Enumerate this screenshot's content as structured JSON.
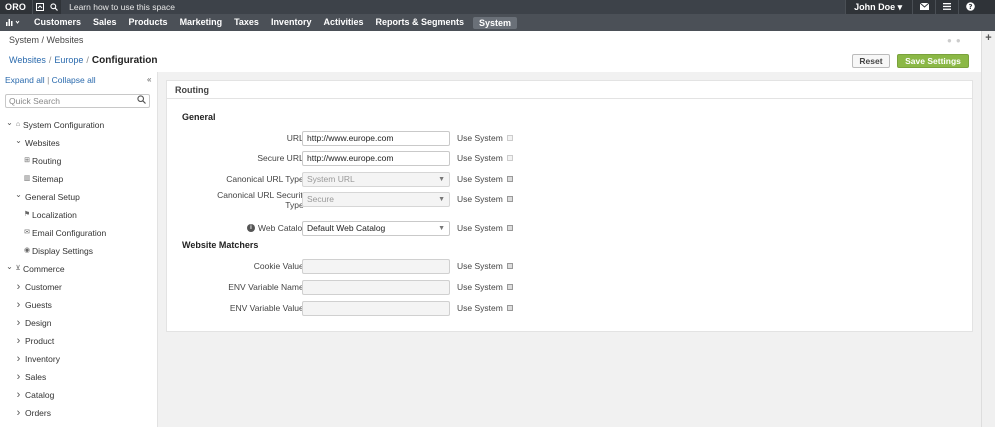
{
  "topbar": {
    "logo": "ORO",
    "learn_text": "Learn how to use this space",
    "user": "John Doe",
    "user_caret": "▾"
  },
  "menu": {
    "items": [
      "Customers",
      "Sales",
      "Products",
      "Marketing",
      "Taxes",
      "Inventory",
      "Activities",
      "Reports & Segments",
      "System"
    ],
    "active": "System"
  },
  "page": {
    "path": "System / Websites",
    "crumbs": [
      "Websites",
      "Europe"
    ],
    "crumb_sep": "/",
    "current": "Configuration",
    "reset_label": "Reset",
    "save_label": "Save Settings"
  },
  "sidebar": {
    "expand_all": "Expand all",
    "bar": "|",
    "collapse_all": "Collapse all",
    "search_placeholder": "Quick Search",
    "tree": [
      {
        "label": "System Configuration",
        "icon": "briefcase-icon",
        "level": 0,
        "arrow": "down"
      },
      {
        "label": "Websites",
        "icon": "",
        "level": 1,
        "arrow": "down"
      },
      {
        "label": "Routing",
        "icon": "sitemap-icon",
        "level": 2,
        "arrow": ""
      },
      {
        "label": "Sitemap",
        "icon": "map-icon",
        "level": 2,
        "arrow": ""
      },
      {
        "label": "General Setup",
        "icon": "",
        "level": 1,
        "arrow": "down"
      },
      {
        "label": "Localization",
        "icon": "flag-icon",
        "level": 2,
        "arrow": ""
      },
      {
        "label": "Email Configuration",
        "icon": "envelope-icon",
        "level": 2,
        "arrow": ""
      },
      {
        "label": "Display Settings",
        "icon": "eye-icon",
        "level": 2,
        "arrow": ""
      },
      {
        "label": "Commerce",
        "icon": "cart-icon",
        "level": 0,
        "arrow": "down"
      },
      {
        "label": "Customer",
        "icon": "",
        "level": 1,
        "arrow": "right"
      },
      {
        "label": "Guests",
        "icon": "",
        "level": 1,
        "arrow": "right"
      },
      {
        "label": "Design",
        "icon": "",
        "level": 1,
        "arrow": "right"
      },
      {
        "label": "Product",
        "icon": "",
        "level": 1,
        "arrow": "right"
      },
      {
        "label": "Inventory",
        "icon": "",
        "level": 1,
        "arrow": "right"
      },
      {
        "label": "Sales",
        "icon": "",
        "level": 1,
        "arrow": "right"
      },
      {
        "label": "Catalog",
        "icon": "",
        "level": 1,
        "arrow": "right"
      },
      {
        "label": "Orders",
        "icon": "",
        "level": 1,
        "arrow": "right"
      }
    ]
  },
  "panel": {
    "title": "Routing",
    "general_title": "General",
    "matchers_title": "Website Matchers",
    "use_system": "Use System",
    "fields": {
      "url": {
        "label": "URL*",
        "value": "http://www.europe.com"
      },
      "secure_url": {
        "label": "Secure URL*",
        "value": "http://www.europe.com"
      },
      "canonical_type": {
        "label": "Canonical URL Type*",
        "value": "System URL"
      },
      "canonical_security": {
        "label_line1": "Canonical URL Security",
        "label_line2": "Type*",
        "value": "Secure"
      },
      "web_catalog": {
        "label": "Web Catalog",
        "value": "Default Web Catalog"
      },
      "cookie_value": {
        "label": "Cookie Value*",
        "value": ""
      },
      "env_name": {
        "label": "ENV Variable Name*",
        "value": ""
      },
      "env_value": {
        "label": "ENV Variable Value*",
        "value": ""
      }
    }
  }
}
